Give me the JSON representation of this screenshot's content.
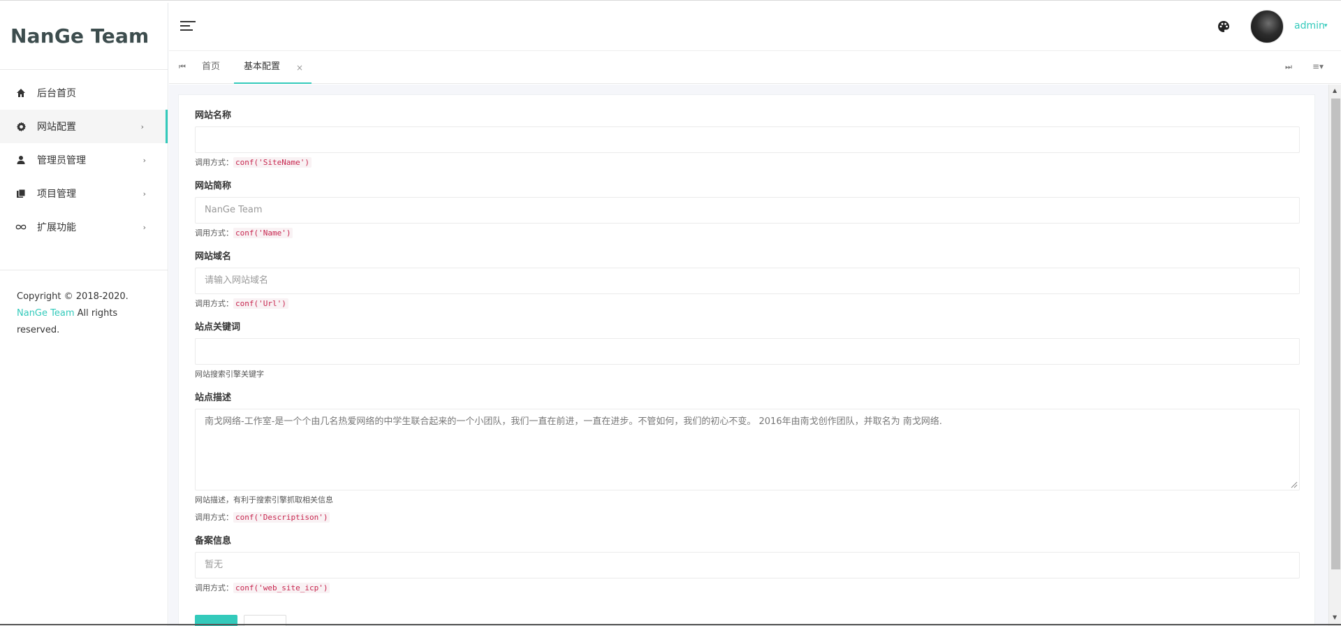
{
  "sidebar": {
    "logo": "NanGe Team",
    "items": [
      {
        "label": "后台首页",
        "icon": "home-icon"
      },
      {
        "label": "网站配置",
        "icon": "gear-icon"
      },
      {
        "label": "管理员管理",
        "icon": "user-icon"
      },
      {
        "label": "项目管理",
        "icon": "book-icon"
      },
      {
        "label": "扩展功能",
        "icon": "infinity-icon"
      }
    ],
    "arrow": "›",
    "copyright_prefix": "Copyright © 2018-2020. ",
    "copyright_link": "NanGe Team",
    "copyright_suffix": " All rights reserved."
  },
  "header": {
    "user": "admin",
    "caret": "▾",
    "palette_icon": "palette-icon",
    "avatar": "avatar"
  },
  "tabs": {
    "nav_left": "⏮",
    "nav_right": "⏭",
    "menu": "≡▾",
    "close": "×",
    "items": [
      {
        "label": "首页"
      },
      {
        "label": "基本配置"
      }
    ]
  },
  "form": {
    "fields": [
      {
        "label": "网站名称",
        "value": "",
        "placeholder": "",
        "help_prefix": "调用方式：",
        "code": "conf('SiteName')"
      },
      {
        "label": "网站简称",
        "value": "NanGe Team",
        "placeholder": "",
        "help_prefix": "调用方式：",
        "code": "conf('Name')"
      },
      {
        "label": "网站域名",
        "value": "",
        "placeholder": "请输入网站域名",
        "help_prefix": "调用方式：",
        "code": "conf('Url')"
      },
      {
        "label": "站点关键词",
        "value": "",
        "placeholder": "",
        "help": "网站搜索引擎关键字"
      },
      {
        "label": "站点描述",
        "value": "南戈网络-工作室-是一个个由几名热爱网络的中学生联合起来的一个小团队，我们一直在前进，一直在进步。不管如何，我们的初心不变。 2016年由南戈创作团队，并取名为 南戈网络.",
        "help": "网站描述，有利于搜索引擎抓取相关信息",
        "help_prefix": "调用方式：",
        "code": "conf('Descriptison')"
      },
      {
        "label": "备案信息",
        "value": "暂无",
        "placeholder": "",
        "help_prefix": "调用方式：",
        "code": "conf('web_site_icp')"
      }
    ]
  },
  "colors": {
    "accent": "#33cabb",
    "code": "#c7254e"
  }
}
